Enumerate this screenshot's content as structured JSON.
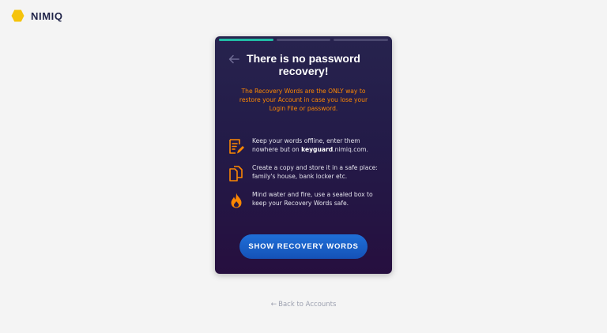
{
  "brand": {
    "name": "NIMIQ",
    "logo_color": "#f5c30c"
  },
  "progress": {
    "total_steps": 3,
    "current_step": 1,
    "active_color": "#21bca5"
  },
  "card": {
    "back_icon": "arrow-left-icon",
    "title": "There is no password recovery!",
    "warning": "The Recovery Words are the ONLY way to restore your Account in case you lose your Login File or password.",
    "tips": [
      {
        "icon": "document-pen-icon",
        "text_before": "Keep your words offline, enter them nowhere but on ",
        "bold": "keyguard",
        "text_after": ".nimiq.com."
      },
      {
        "icon": "copy-icon",
        "text_before": "Create a copy and store it in a safe place: family's house, bank locker etc.",
        "bold": "",
        "text_after": ""
      },
      {
        "icon": "fire-icon",
        "text_before": "Mind water and fire, use a sealed box to keep your Recovery Words safe.",
        "bold": "",
        "text_after": ""
      }
    ],
    "cta_label": "SHOW RECOVERY WORDS"
  },
  "footer": {
    "back_link_label": "Back to Accounts",
    "back_link_icon": "arrow-left-icon"
  },
  "colors": {
    "accent_orange": "#fc8702",
    "button_blue": "#1f6fd8",
    "card_bg": "#241d4a"
  }
}
